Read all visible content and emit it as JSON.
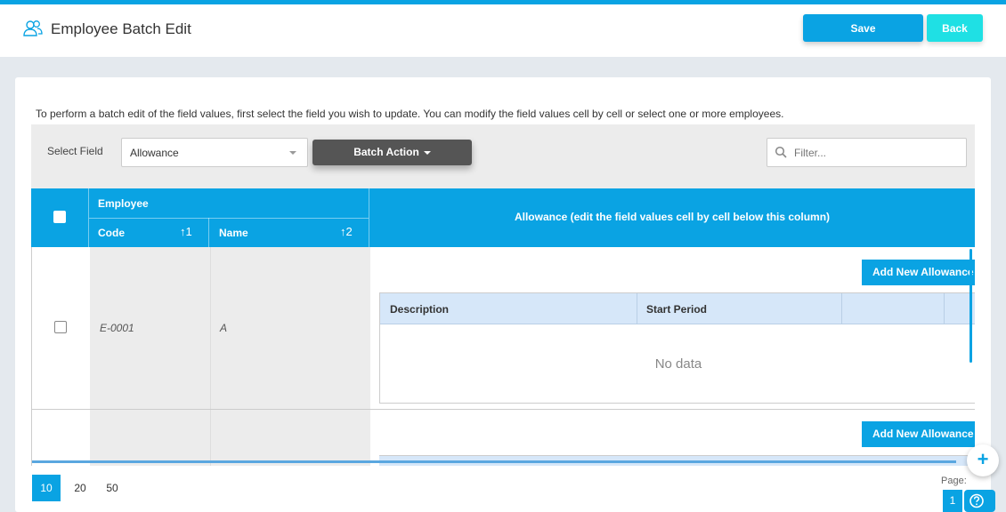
{
  "header": {
    "title": "Employee Batch Edit",
    "save_label": "Save",
    "back_label": "Back"
  },
  "intro_text": "To perform a batch edit of the field values, first select the field you wish to update. You can modify the field values cell by cell or select one or more employees.",
  "toolbar": {
    "select_field_label": "Select Field",
    "selected_field": "Allowance",
    "batch_action_label": "Batch Action",
    "filter_placeholder": "Filter..."
  },
  "grid": {
    "group_header": "Employee",
    "columns": [
      {
        "label": "Code",
        "sort_order": "1"
      },
      {
        "label": "Name",
        "sort_order": "2"
      }
    ],
    "field_header": "Allowance (edit the field values cell by cell below this column)",
    "rows": [
      {
        "code": "E-0001",
        "name": "A",
        "add_label": "Add New Allowance",
        "sub_columns": [
          "Description",
          "Start Period"
        ],
        "empty_text": "No data"
      },
      {
        "add_label": "Add New Allowance"
      }
    ]
  },
  "pagination": {
    "page_sizes": [
      "10",
      "20",
      "50"
    ],
    "active_size": "10",
    "page_label": "Page:",
    "current_page": "1"
  },
  "colors": {
    "accent": "#0aa3e3",
    "back_button": "#1fe0e4",
    "batch_button": "#555555",
    "sub_header": "#d6e7f9"
  }
}
